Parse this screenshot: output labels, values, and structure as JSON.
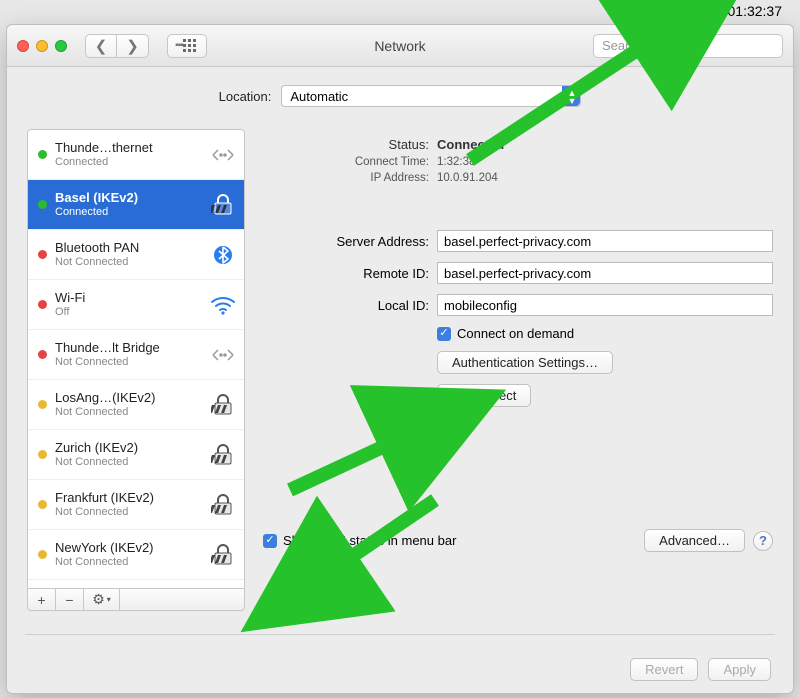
{
  "menubar": {
    "clock": "01:32:37"
  },
  "window": {
    "title": "Network"
  },
  "toolbar": {
    "search_placeholder": "Search"
  },
  "location": {
    "label": "Location:",
    "value": "Automatic"
  },
  "sidebar": {
    "items": [
      {
        "name": "Thunde…thernet",
        "sub": "Connected",
        "status": "green",
        "icon": "ethernet"
      },
      {
        "name": "Basel (IKEv2)",
        "sub": "Connected",
        "status": "green",
        "icon": "lock"
      },
      {
        "name": "Bluetooth PAN",
        "sub": "Not Connected",
        "status": "red",
        "icon": "bluetooth"
      },
      {
        "name": "Wi-Fi",
        "sub": "Off",
        "status": "red",
        "icon": "wifi"
      },
      {
        "name": "Thunde…lt Bridge",
        "sub": "Not Connected",
        "status": "red",
        "icon": "ethernet"
      },
      {
        "name": "LosAng…(IKEv2)",
        "sub": "Not Connected",
        "status": "yellow",
        "icon": "lock"
      },
      {
        "name": "Zurich (IKEv2)",
        "sub": "Not Connected",
        "status": "yellow",
        "icon": "lock"
      },
      {
        "name": "Frankfurt (IKEv2)",
        "sub": "Not Connected",
        "status": "yellow",
        "icon": "lock"
      },
      {
        "name": "NewYork (IKEv2)",
        "sub": "Not Connected",
        "status": "yellow",
        "icon": "lock"
      }
    ]
  },
  "detail": {
    "status_label": "Status:",
    "status_value": "Connected",
    "connect_time_label": "Connect Time:",
    "connect_time_value": "1:32:38",
    "ip_label": "IP Address:",
    "ip_value": "10.0.91.204",
    "server_label": "Server Address:",
    "server_value": "basel.perfect-privacy.com",
    "remote_label": "Remote ID:",
    "remote_value": "basel.perfect-privacy.com",
    "local_label": "Local ID:",
    "local_value": "mobileconfig",
    "connect_on_demand": "Connect on demand",
    "auth_settings": "Authentication Settings…",
    "disconnect": "Disconnect",
    "show_vpn_menu": "Show VPN status in menu bar",
    "advanced": "Advanced…"
  },
  "footer": {
    "revert": "Revert",
    "apply": "Apply"
  }
}
